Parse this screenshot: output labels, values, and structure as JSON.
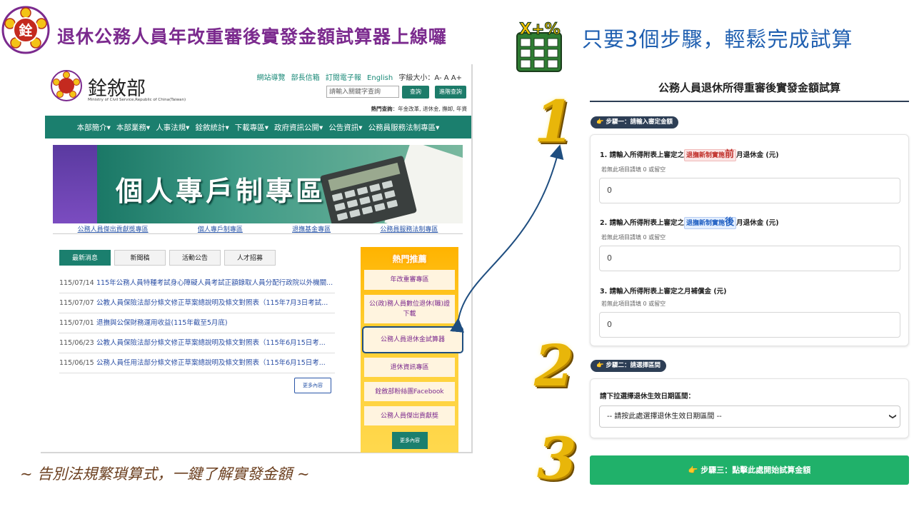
{
  "banner": {
    "title": "退休公務人員年改重審後實發金額試算器上線囉",
    "subtitle": "只要3個步驟，輕鬆完成試算",
    "calc_icon_text": "X+%",
    "logo_char": "銓"
  },
  "site": {
    "name": "銓敘部",
    "english_name": "Ministry of Civil Service,Republic of China(Taiwan)",
    "top_links": [
      "網站導覽",
      "部長信箱",
      "訂閱電子報",
      "English"
    ],
    "font_size_label": "字級大小：A-  A  A+",
    "search_placeholder": "請輸入關鍵字查詢",
    "search_button": "查詢",
    "advanced_search_button": "進階查詢",
    "hot_search_label": "熱門查詢",
    "hot_search_terms": "：年金改革, 退休金, 撫卹, 年資",
    "nav": [
      "本部簡介▾",
      "本部業務▾",
      "人事法規▾",
      "銓敘統計▾",
      "下載專區▾",
      "政府資訊公開▾",
      "公告資訊▾",
      "公務員服務法制專區▾"
    ],
    "hero_text": "個人專戶制專區",
    "hero_labels": [
      "公務人員傑出貢獻獎專區",
      "個人專戶制專區",
      "退撫基金專區",
      "公務員服務法制專區"
    ],
    "tabs": [
      "最新消息",
      "新聞稿",
      "活動公告",
      "人才招募"
    ],
    "news": [
      {
        "date": "115/07/14",
        "title": "115年公務人員特種考試身心障礙人員考試正額錄取人員分配行政院以外機關..."
      },
      {
        "date": "115/07/07",
        "title": "公教人員保險法部分條文修正草案總說明及條文對照表（115年7月3日考試..."
      },
      {
        "date": "115/07/01",
        "title": "退撫與公保財務運用收益(115年截至5月底)"
      },
      {
        "date": "115/06/23",
        "title": "公教人員保險法部分條文修正草案總說明及條文對照表（115年6月15日考..."
      },
      {
        "date": "115/06/15",
        "title": "公務人員任用法部分條文修正草案總說明及條文對照表（115年6月15日考..."
      }
    ],
    "more_button": "更多內容",
    "hot_title": "熱門推薦",
    "hot_items": [
      "年改重審專區",
      "公(政)務人員數位退休(職)證下載",
      "公務人員退休金試算器",
      "退休資訊專區",
      "銓敘部粉絲團Facebook",
      "公務人員傑出貢獻獎"
    ],
    "hot_more": "更多內容"
  },
  "slogan": "~ 告別法規繁瑣算式，一鍵了解實發金額 ~",
  "steps": [
    "1",
    "2",
    "3"
  ],
  "calculator": {
    "title": "公務人員退休所得重審後實發金額試算",
    "step1_label": "👉 步驟一：請輸入審定金額",
    "field1": {
      "pre": "1. 請輸入所得附表上審定之",
      "tag": "退撫新制實施",
      "tag_emph": "前",
      "post": "月退休金 (元)",
      "hint": "若無此項目請填 0 或留空",
      "value": "0"
    },
    "field2": {
      "pre": "2. 請輸入所得附表上審定之",
      "tag": "退撫新制實施",
      "tag_emph": "後",
      "post": "月退休金 (元)",
      "hint": "若無此項目請填 0 或留空",
      "value": "0"
    },
    "field3": {
      "label": "3. 請輸入所得附表上審定之月補償金 (元)",
      "hint": "若無此項目請填 0 或留空",
      "value": "0"
    },
    "step2_label": "👉 步驟二：請選擇區間",
    "select_label": "請下拉選擇退休生效日期區間：",
    "select_value": "-- 請按此處選擇退休生效日期區間 --",
    "step3_button": "👉 步驟三：點擊此處開始試算金額"
  }
}
